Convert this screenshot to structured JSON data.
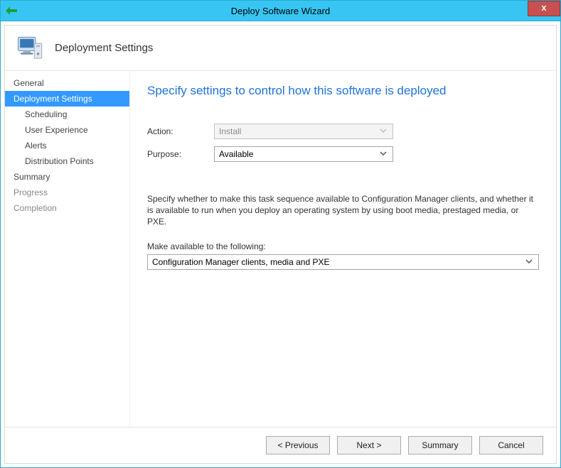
{
  "window": {
    "title": "Deploy Software Wizard"
  },
  "header": {
    "title": "Deployment Settings"
  },
  "sidebar": {
    "items": [
      {
        "label": "General",
        "sub": false,
        "selected": false,
        "disabled": false
      },
      {
        "label": "Deployment Settings",
        "sub": false,
        "selected": true,
        "disabled": false
      },
      {
        "label": "Scheduling",
        "sub": true,
        "selected": false,
        "disabled": false
      },
      {
        "label": "User Experience",
        "sub": true,
        "selected": false,
        "disabled": false
      },
      {
        "label": "Alerts",
        "sub": true,
        "selected": false,
        "disabled": false
      },
      {
        "label": "Distribution Points",
        "sub": true,
        "selected": false,
        "disabled": false
      },
      {
        "label": "Summary",
        "sub": false,
        "selected": false,
        "disabled": false
      },
      {
        "label": "Progress",
        "sub": false,
        "selected": false,
        "disabled": true
      },
      {
        "label": "Completion",
        "sub": false,
        "selected": false,
        "disabled": true
      }
    ]
  },
  "content": {
    "page_title": "Specify settings to control how this software is deployed",
    "action_label": "Action:",
    "action_value": "Install",
    "purpose_label": "Purpose:",
    "purpose_value": "Available",
    "description": "Specify whether to make this task sequence available to Configuration Manager clients, and whether it is available to run when you deploy an operating system by using boot media, prestaged media, or PXE.",
    "available_label": "Make available to the following:",
    "available_value": "Configuration Manager clients, media and PXE"
  },
  "footer": {
    "previous": "< Previous",
    "next": "Next >",
    "summary": "Summary",
    "cancel": "Cancel"
  }
}
